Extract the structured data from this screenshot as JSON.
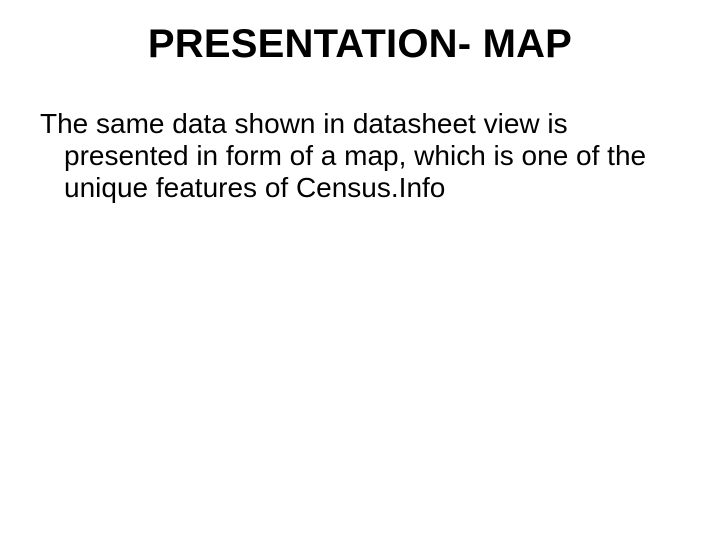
{
  "slide": {
    "title": "PRESENTATION- MAP",
    "body": "The same data shown in datasheet view is presented in form of a map, which is one of the unique features of Census.Info"
  }
}
